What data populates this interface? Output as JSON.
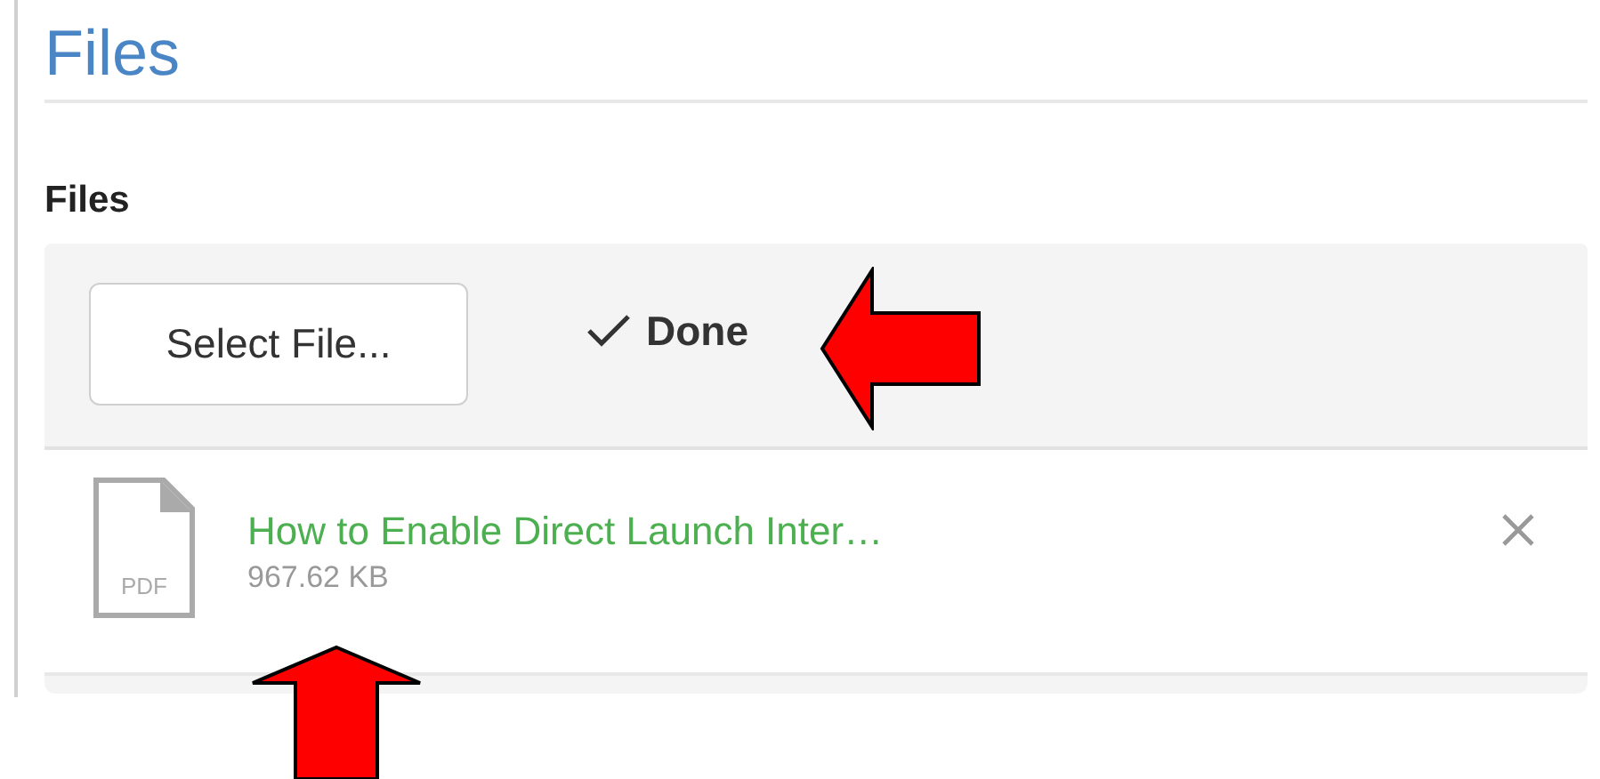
{
  "page_title": "Files",
  "section": {
    "label": "Files",
    "select_button": "Select File...",
    "status": {
      "kind": "done",
      "label": "Done"
    }
  },
  "files": [
    {
      "name": "How to Enable Direct Launch Inter…",
      "size": "967.62 KB",
      "type": "PDF"
    }
  ]
}
